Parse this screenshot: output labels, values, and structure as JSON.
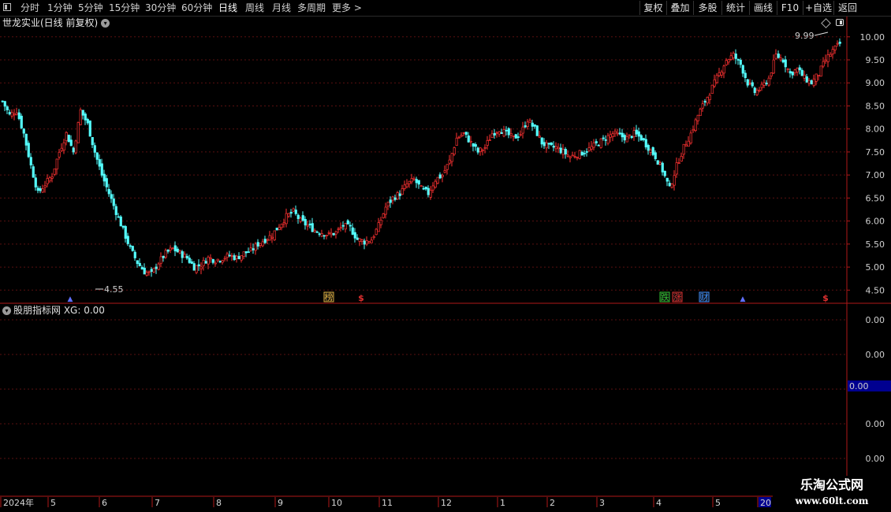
{
  "toolbar": {
    "periods": [
      "分时",
      "1分钟",
      "5分钟",
      "15分钟",
      "30分钟",
      "60分钟",
      "日线",
      "周线",
      "月线",
      "多周期",
      "更多 >"
    ],
    "active_period": "日线",
    "tools": [
      "复权",
      "叠加",
      "多股",
      "统计",
      "画线",
      "F10",
      "+自选",
      "返回"
    ]
  },
  "main_panel": {
    "title": "世龙实业(日线 前复权)",
    "price_axis": [
      "10.00",
      "9.50",
      "9.00",
      "8.50",
      "8.00",
      "7.50",
      "7.00",
      "6.50",
      "6.00",
      "5.50",
      "5.00",
      "4.50"
    ],
    "high_annotation": "9.99",
    "low_annotation": "4.55",
    "markers": [
      {
        "label": "榜",
        "color": "#e0b040"
      },
      {
        "label": "$",
        "color": "#e03030"
      },
      {
        "label": "跌",
        "color": "#30c030"
      },
      {
        "label": "涨",
        "color": "#e03030"
      },
      {
        "label": "财",
        "color": "#4090ff"
      },
      {
        "label": "$",
        "color": "#e03030"
      }
    ]
  },
  "indicator_panel": {
    "title": "股朋指标网 XG: 0.00",
    "axis": [
      "0.00",
      "0.00",
      "0.00",
      "0.00",
      "0.00"
    ],
    "current_value": "0.00"
  },
  "date_axis": [
    "2024年",
    "5",
    "6",
    "7",
    "8",
    "9",
    "10",
    "11",
    "12",
    "1",
    "2",
    "3",
    "4",
    "5",
    "20"
  ],
  "watermark": {
    "line1": "乐淘公式网",
    "line2": "www.60lt.com"
  },
  "colors": {
    "up": "#ff3232",
    "down": "#54ffff",
    "grid": "#5a1010",
    "axis": "#b01818",
    "label_highlight": "#000090"
  },
  "chart_data": {
    "type": "candlestick",
    "title": "世龙实业(日线 前复权)",
    "ylim": [
      4.3,
      10.15
    ],
    "yticks": [
      4.5,
      5.0,
      5.5,
      6.0,
      6.5,
      7.0,
      7.5,
      8.0,
      8.5,
      9.0,
      9.5,
      10.0
    ],
    "x_months": [
      "2024年",
      "5",
      "6",
      "7",
      "8",
      "9",
      "10",
      "11",
      "12",
      "1",
      "2",
      "3",
      "4",
      "5",
      "20"
    ],
    "close_path": [
      [
        0,
        8.6
      ],
      [
        3,
        8.3
      ],
      [
        6,
        8.4
      ],
      [
        9,
        7.9
      ],
      [
        12,
        7.2
      ],
      [
        15,
        6.6
      ],
      [
        18,
        6.8
      ],
      [
        21,
        7.0
      ],
      [
        24,
        7.5
      ],
      [
        27,
        7.9
      ],
      [
        30,
        7.5
      ],
      [
        33,
        8.4
      ],
      [
        36,
        8.1
      ],
      [
        39,
        7.5
      ],
      [
        42,
        7.0
      ],
      [
        45,
        6.6
      ],
      [
        48,
        6.2
      ],
      [
        51,
        5.8
      ],
      [
        54,
        5.4
      ],
      [
        57,
        5.1
      ],
      [
        60,
        4.9
      ],
      [
        63,
        4.85
      ],
      [
        66,
        5.1
      ],
      [
        69,
        5.3
      ],
      [
        72,
        5.4
      ],
      [
        75,
        5.3
      ],
      [
        78,
        5.2
      ],
      [
        81,
        5.0
      ],
      [
        84,
        5.05
      ],
      [
        87,
        5.2
      ],
      [
        90,
        5.15
      ],
      [
        93,
        5.2
      ],
      [
        96,
        5.25
      ],
      [
        99,
        5.2
      ],
      [
        102,
        5.3
      ],
      [
        105,
        5.35
      ],
      [
        108,
        5.5
      ],
      [
        111,
        5.6
      ],
      [
        114,
        5.7
      ],
      [
        117,
        5.9
      ],
      [
        120,
        6.1
      ],
      [
        123,
        6.2
      ],
      [
        126,
        6.0
      ],
      [
        129,
        5.9
      ],
      [
        132,
        5.8
      ],
      [
        135,
        5.75
      ],
      [
        138,
        5.7
      ],
      [
        141,
        5.75
      ],
      [
        144,
        5.9
      ],
      [
        147,
        5.85
      ],
      [
        150,
        5.6
      ],
      [
        153,
        5.55
      ],
      [
        156,
        5.6
      ],
      [
        159,
        5.9
      ],
      [
        162,
        6.3
      ],
      [
        165,
        6.5
      ],
      [
        168,
        6.6
      ],
      [
        171,
        6.8
      ],
      [
        174,
        6.9
      ],
      [
        177,
        6.7
      ],
      [
        180,
        6.6
      ],
      [
        183,
        6.9
      ],
      [
        186,
        7.0
      ],
      [
        189,
        7.3
      ],
      [
        192,
        7.8
      ],
      [
        195,
        7.9
      ],
      [
        198,
        7.7
      ],
      [
        201,
        7.5
      ],
      [
        204,
        7.6
      ],
      [
        207,
        7.9
      ],
      [
        210,
        8.0
      ],
      [
        213,
        7.9
      ],
      [
        216,
        7.8
      ],
      [
        219,
        7.9
      ],
      [
        222,
        8.2
      ],
      [
        225,
        8.0
      ],
      [
        228,
        7.7
      ],
      [
        231,
        7.6
      ],
      [
        234,
        7.6
      ],
      [
        237,
        7.5
      ],
      [
        240,
        7.4
      ],
      [
        243,
        7.45
      ],
      [
        246,
        7.5
      ],
      [
        249,
        7.6
      ],
      [
        252,
        7.7
      ],
      [
        255,
        7.8
      ],
      [
        258,
        7.9
      ],
      [
        261,
        7.85
      ],
      [
        264,
        7.8
      ],
      [
        267,
        7.9
      ],
      [
        270,
        7.8
      ],
      [
        273,
        7.6
      ],
      [
        276,
        7.4
      ],
      [
        279,
        7.1
      ],
      [
        282,
        6.7
      ],
      [
        285,
        7.2
      ],
      [
        288,
        7.6
      ],
      [
        291,
        7.9
      ],
      [
        294,
        8.3
      ],
      [
        297,
        8.6
      ],
      [
        300,
        8.9
      ],
      [
        303,
        9.2
      ],
      [
        306,
        9.5
      ],
      [
        309,
        9.6
      ],
      [
        312,
        9.4
      ],
      [
        315,
        9.0
      ],
      [
        318,
        8.8
      ],
      [
        321,
        8.9
      ],
      [
        324,
        9.1
      ],
      [
        327,
        9.6
      ],
      [
        330,
        9.5
      ],
      [
        333,
        9.2
      ],
      [
        336,
        9.3
      ],
      [
        339,
        9.1
      ],
      [
        342,
        9.0
      ],
      [
        345,
        9.2
      ],
      [
        348,
        9.5
      ],
      [
        351,
        9.7
      ],
      [
        354,
        9.85
      ]
    ],
    "indicator": {
      "name": "XG",
      "value": 0.0
    }
  }
}
